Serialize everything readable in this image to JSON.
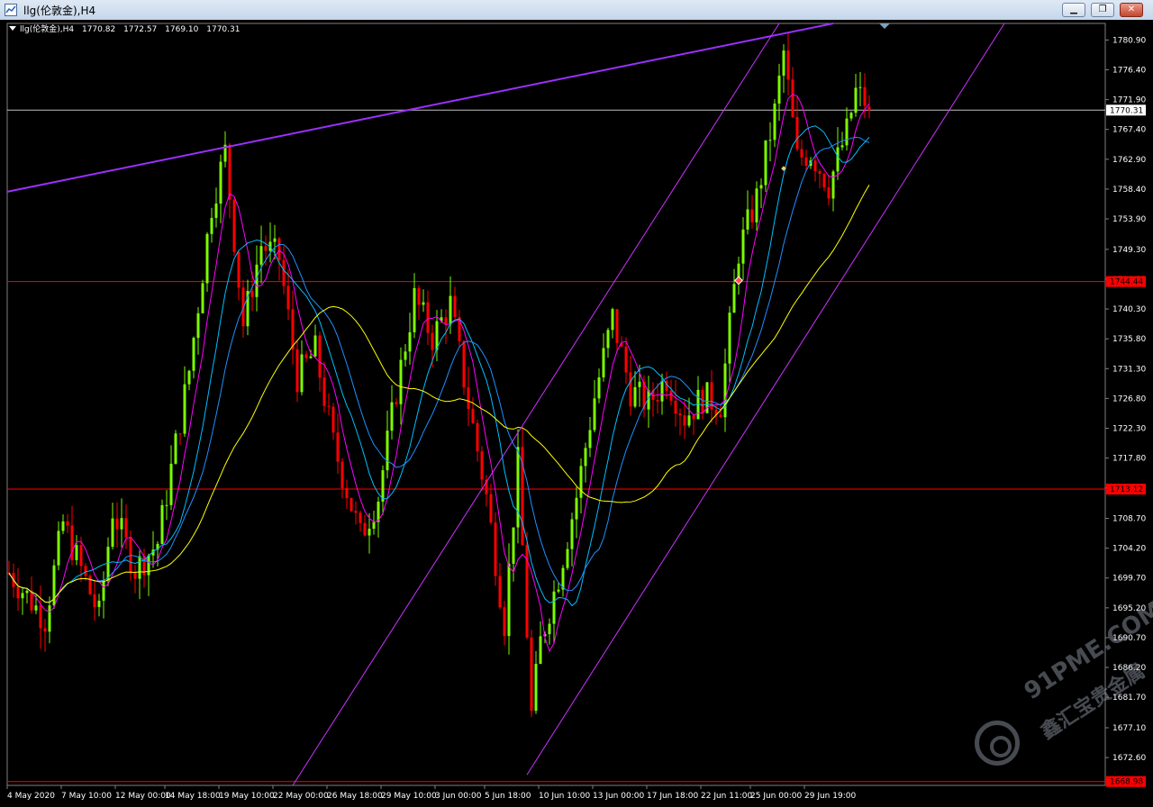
{
  "window": {
    "title": "llg(伦敦金),H4",
    "minimize_label": "▁",
    "restore_label": "❐",
    "close_label": "✕"
  },
  "chart_header": {
    "symbol": "llg(伦敦金),H4",
    "open": "1770.82",
    "high": "1772.57",
    "low": "1769.10",
    "close": "1770.31"
  },
  "colors": {
    "background": "#000000",
    "bull_candle": "#7cfc00",
    "bear_candle": "#ff0000",
    "axis_text": "#ffffff",
    "horizontal_line": "#ff0000",
    "bid_line": "#c0c0c0",
    "channel_line": "#cc33ff",
    "trend_line": "#9b30ff",
    "ma_fast": "#ff00ff",
    "ma_mid": "#00bfff",
    "ma_slow": "#1e90ff",
    "ma_long": "#ffff00"
  },
  "chart_data": {
    "type": "candlestick",
    "ylim": [
      1668.4,
      1783.4
    ],
    "y_ticks": [
      "1780.90",
      "1776.40",
      "1771.90",
      "1767.40",
      "1762.90",
      "1758.40",
      "1753.90",
      "1749.30",
      "1744.80",
      "1740.30",
      "1735.80",
      "1731.30",
      "1726.80",
      "1722.30",
      "1717.80",
      "1713.30",
      "1708.70",
      "1704.20",
      "1699.70",
      "1695.20",
      "1690.70",
      "1686.20",
      "1681.70",
      "1677.10",
      "1672.60"
    ],
    "x_labels": [
      "4 May 2020",
      "7 May 10:00",
      "12 May 00:00",
      "14 May 18:00",
      "19 May 10:00",
      "22 May 00:00",
      "26 May 18:00",
      "29 May 10:00",
      "3 Jun 00:00",
      "5 Jun 18:00",
      "10 Jun 10:00",
      "13 Jun 00:00",
      "17 Jun 18:00",
      "22 Jun 11:00",
      "25 Jun 00:00",
      "29 Jun 19:00"
    ],
    "horizontal_lines": [
      {
        "price": 1744.44,
        "label": "1744.44",
        "color": "#ff0000"
      },
      {
        "price": 1713.12,
        "label": "1713.12",
        "color": "#ff0000"
      },
      {
        "price": 1668.98,
        "label": "1668.98",
        "color": "#ff0000"
      }
    ],
    "bid_line": {
      "price": 1770.31,
      "label": "1770.31"
    },
    "anchors": [
      [
        0,
        1700.5
      ],
      [
        8,
        1693.5
      ],
      [
        12,
        1708
      ],
      [
        20,
        1694
      ],
      [
        23,
        1710
      ],
      [
        28,
        1701
      ],
      [
        33,
        1705
      ],
      [
        40,
        1731
      ],
      [
        45,
        1756
      ],
      [
        48,
        1764
      ],
      [
        52,
        1738
      ],
      [
        56,
        1750
      ],
      [
        60,
        1748
      ],
      [
        64,
        1730
      ],
      [
        68,
        1734
      ],
      [
        72,
        1720
      ],
      [
        78,
        1706
      ],
      [
        82,
        1712
      ],
      [
        86,
        1728
      ],
      [
        90,
        1742
      ],
      [
        94,
        1736
      ],
      [
        98,
        1741
      ],
      [
        102,
        1726
      ],
      [
        106,
        1712
      ],
      [
        110,
        1693
      ],
      [
        113,
        1717
      ],
      [
        116,
        1679
      ],
      [
        118,
        1690
      ],
      [
        122,
        1700
      ],
      [
        126,
        1712
      ],
      [
        130,
        1727
      ],
      [
        134,
        1739
      ],
      [
        138,
        1728
      ],
      [
        142,
        1726
      ],
      [
        146,
        1730
      ],
      [
        150,
        1724
      ],
      [
        154,
        1727
      ],
      [
        158,
        1726
      ],
      [
        162,
        1749
      ],
      [
        166,
        1757
      ],
      [
        170,
        1770
      ],
      [
        172,
        1779
      ],
      [
        175,
        1763
      ],
      [
        178,
        1764
      ],
      [
        182,
        1759
      ],
      [
        186,
        1767
      ],
      [
        188,
        1773
      ],
      [
        191,
        1771
      ]
    ]
  }
}
